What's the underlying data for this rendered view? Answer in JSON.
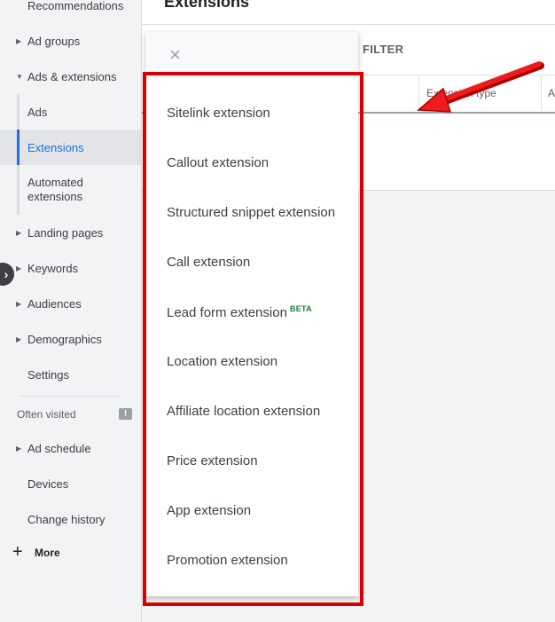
{
  "header": {
    "title": "Extensions"
  },
  "sidebar": {
    "items": [
      {
        "label": "Recommendations"
      },
      {
        "label": "Ad groups"
      },
      {
        "label": "Ads & extensions"
      },
      {
        "label": "Ads"
      },
      {
        "label": "Extensions"
      },
      {
        "label": "Automated extensions"
      },
      {
        "label": "Landing pages"
      },
      {
        "label": "Keywords"
      },
      {
        "label": "Audiences"
      },
      {
        "label": "Demographics"
      },
      {
        "label": "Settings"
      }
    ],
    "often_visited_title": "Often visited",
    "often_visited": [
      {
        "label": "Ad schedule"
      },
      {
        "label": "Devices"
      },
      {
        "label": "Change history"
      }
    ],
    "more_label": "More",
    "collapse_glyph": "›",
    "feedback_glyph": "!"
  },
  "toolbar": {
    "filter_label": "FILTER"
  },
  "table": {
    "columns": [
      {
        "label": "Extension type"
      },
      {
        "label": "A"
      }
    ]
  },
  "dropdown": {
    "close_glyph": "×",
    "items": [
      {
        "label": "Sitelink extension"
      },
      {
        "label": "Callout extension"
      },
      {
        "label": "Structured snippet extension"
      },
      {
        "label": "Call extension"
      },
      {
        "label": "Lead form extension",
        "badge": "BETA"
      },
      {
        "label": "Location extension"
      },
      {
        "label": "Affiliate location extension"
      },
      {
        "label": "Price extension"
      },
      {
        "label": "App extension"
      },
      {
        "label": "Promotion extension"
      }
    ]
  },
  "colors": {
    "highlight": "#d80000",
    "accent": "#1a73e8",
    "beta": "#188038"
  }
}
